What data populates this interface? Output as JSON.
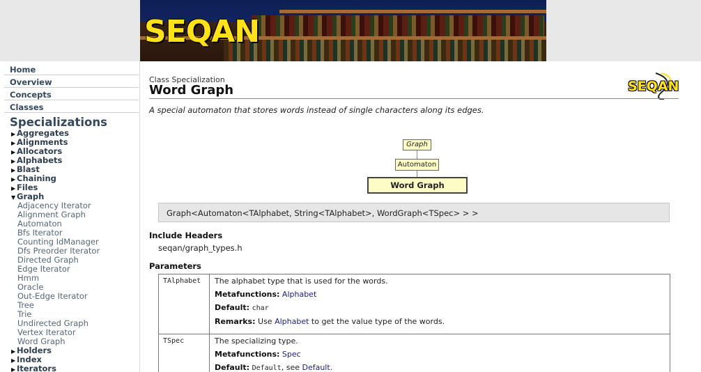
{
  "banner": {
    "logo_text": "SEQAN"
  },
  "nav": {
    "top_items": [
      "Home",
      "Overview",
      "Concepts",
      "Classes"
    ],
    "section_title": "Specializations",
    "categories_before": [
      "Aggregates",
      "Alignments",
      "Allocators",
      "Alphabets",
      "Blast",
      "Chaining",
      "Files"
    ],
    "expanded_category": "Graph",
    "graph_items": [
      "Adjacency Iterator",
      "Alignment Graph",
      "Automaton",
      "Bfs Iterator",
      "Counting IdManager",
      "Dfs Preorder Iterator",
      "Directed Graph",
      "Edge Iterator",
      "Hmm",
      "Oracle",
      "Out-Edge Iterator",
      "Tree",
      "Trie",
      "Undirected Graph",
      "Vertex Iterator",
      "Word Graph"
    ],
    "categories_after": [
      "Holders",
      "Index",
      "Iterators"
    ]
  },
  "header": {
    "kind": "Class Specialization",
    "title": "Word Graph",
    "logo_text": "SEQAN"
  },
  "description": "A special automaton that stores words instead of single characters along its edges.",
  "diagram": {
    "top": "Graph",
    "middle": "Automaton",
    "bottom": "Word Graph"
  },
  "signature": "Graph<Automaton<TAlphabet, String<TAlphabet>, WordGraph<TSpec> > >",
  "include_headers": {
    "title": "Include Headers",
    "file": "seqan/graph_types.h"
  },
  "parameters": {
    "title": "Parameters",
    "rows": [
      {
        "name": "TAlphabet",
        "desc": "The alphabet type that is used for the words.",
        "metafunctions_label": "Metafunctions:",
        "metafunctions_value": "Alphabet",
        "default_label": "Default:",
        "default_value": "char",
        "remarks_label": "Remarks:",
        "remarks_pre": "Use ",
        "remarks_link": "Alphabet",
        "remarks_post": " to get the value type of the words."
      },
      {
        "name": "TSpec",
        "desc": "The specializing type.",
        "metafunctions_label": "Metafunctions:",
        "metafunctions_value": "Spec",
        "default_label": "Default:",
        "default_value": "Default",
        "default_sep": ", see ",
        "default_link": "Default",
        "default_end": "."
      }
    ]
  },
  "colors": {
    "banner_logo": "#ffe21a",
    "nav_text": "#34485e",
    "link": "#1a1e8c",
    "diagram_fill": "#fdfcc7",
    "signature_bg": "#e6e6e6"
  }
}
